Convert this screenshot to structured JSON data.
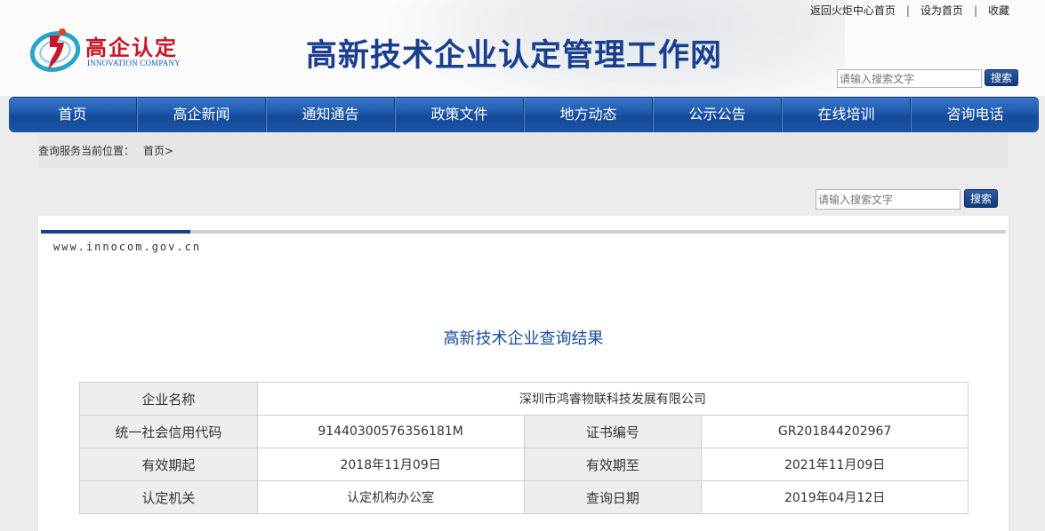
{
  "top_links": {
    "return_home": "返回火炬中心首页",
    "set_home": "设为首页",
    "favorite": "收藏",
    "separator": "|"
  },
  "logo": {
    "name_cn": "高企认定",
    "name_en": "INNOVATION COMPANY",
    "icon": "innovation-swirl-logo"
  },
  "site_title": "高新技术企业认定管理工作网",
  "search": {
    "placeholder": "请输入搜索文字",
    "button": "搜索"
  },
  "nav": {
    "items": [
      "首页",
      "高企新闻",
      "通知通告",
      "政策文件",
      "地方动态",
      "公示公告",
      "在线培训",
      "咨询电话"
    ]
  },
  "breadcrumb": {
    "label": "查询服务当前位置：",
    "home": "首页>"
  },
  "content": {
    "site_url": "www.innocom.gov.cn",
    "result_title": "高新技术企业查询结果",
    "table": {
      "company_name_label": "企业名称",
      "company_name": "深圳市鸿睿物联科技发展有限公司",
      "credit_code_label": "统一社会信用代码",
      "credit_code": "91440300576356181M",
      "cert_no_label": "证书编号",
      "cert_no": "GR201844202967",
      "valid_from_label": "有效期起",
      "valid_from": "2018年11月09日",
      "valid_to_label": "有效期至",
      "valid_to": "2021年11月09日",
      "authority_label": "认定机关",
      "authority": "认定机构办公室",
      "query_date_label": "查询日期",
      "query_date": "2019年04月12日"
    }
  },
  "colors": {
    "brand_blue": "#1a3f8f",
    "nav_blue": "#1e58ad",
    "logo_red": "#c7172b",
    "title_blue": "#1a4d9a"
  }
}
